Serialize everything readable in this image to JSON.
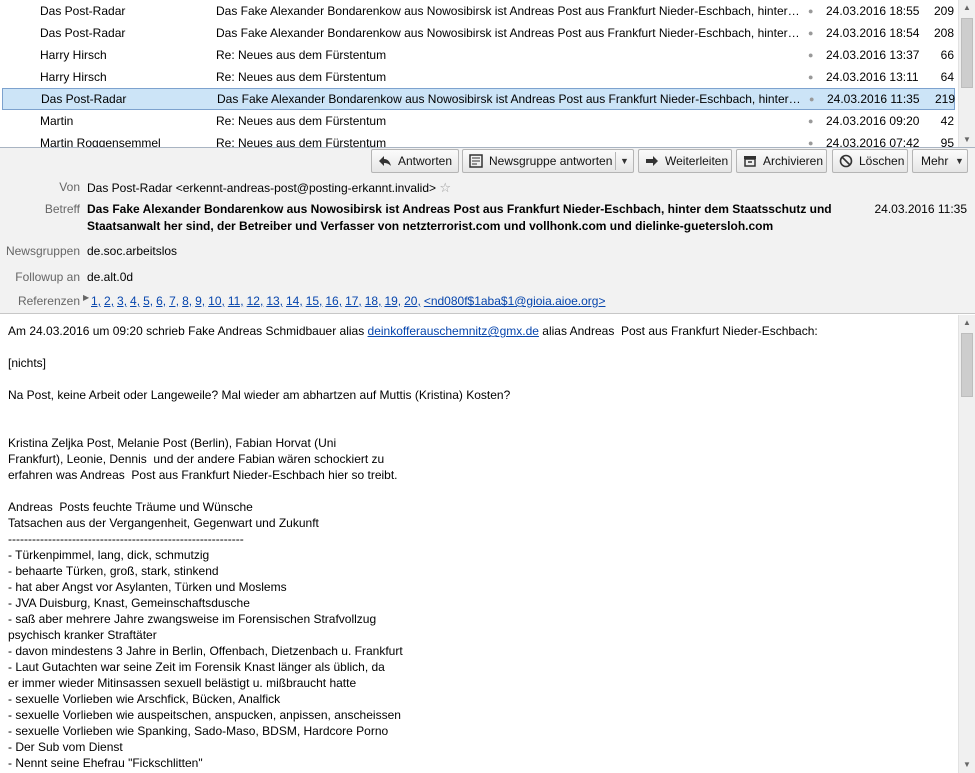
{
  "message_list": [
    {
      "from": "Das Post-Radar",
      "subject": "Das Fake Alexander Bondarenkow aus Nowosibirsk ist Andreas Post aus Frankfurt Nieder-Eschbach, hinter de...",
      "date": "24.03.2016 18:55",
      "size": "209",
      "selected": false
    },
    {
      "from": "Das Post-Radar",
      "subject": "Das Fake Alexander Bondarenkow aus Nowosibirsk ist Andreas Post aus Frankfurt Nieder-Eschbach, hinter de...",
      "date": "24.03.2016 18:54",
      "size": "208",
      "selected": false
    },
    {
      "from": "Harry Hirsch",
      "subject": "Re: Neues aus dem Fürstentum",
      "date": "24.03.2016 13:37",
      "size": "66",
      "selected": false
    },
    {
      "from": "Harry Hirsch",
      "subject": "Re: Neues aus dem Fürstentum",
      "date": "24.03.2016 13:11",
      "size": "64",
      "selected": false
    },
    {
      "from": "Das Post-Radar",
      "subject": "Das Fake Alexander Bondarenkow aus Nowosibirsk ist Andreas Post aus Frankfurt Nieder-Eschbach, hinter de...",
      "date": "24.03.2016 11:35",
      "size": "219",
      "selected": true
    },
    {
      "from": "Martin",
      "subject": "Re: Neues aus dem Fürstentum",
      "date": "24.03.2016 09:20",
      "size": "42",
      "selected": false
    },
    {
      "from": "Martin Roggensemmel",
      "subject": "Re: Neues aus dem Fürstentum",
      "date": "24.03.2016 07:42",
      "size": "95",
      "selected": false
    }
  ],
  "toolbar": {
    "reply": "Antworten",
    "reply_group": "Newsgruppe antworten",
    "forward": "Weiterleiten",
    "archive": "Archivieren",
    "delete": "Löschen",
    "more": "Mehr"
  },
  "header": {
    "from_label": "Von",
    "from_value": "Das Post-Radar <erkennt-andreas-post@posting-erkannt.invalid>",
    "subject_label": "Betreff",
    "subject_value": "Das Fake Alexander Bondarenkow aus Nowosibirsk ist Andreas Post aus Frankfurt Nieder-Eschbach, hinter dem Staatsschutz und Staatsanwalt her sind, der Betreiber und Verfasser von netzterrorist.com und vollhonk.com und dielinke-guetersloh.com",
    "date": "24.03.2016 11:35",
    "newsgroups_label": "Newsgruppen",
    "newsgroups_value": "de.soc.arbeitslos",
    "followup_label": "Followup an",
    "followup_value": "de.alt.0d",
    "references_label": "Referenzen",
    "references": [
      "1,",
      "2,",
      "3,",
      "4,",
      "5,",
      "6,",
      "7,",
      "8,",
      "9,",
      "10,",
      "11,",
      "12,",
      "13,",
      "14,",
      "15,",
      "16,",
      "17,",
      "18,",
      "19,",
      "20,",
      "<nd080f$1aba$1@gioia.aioe.org>"
    ]
  },
  "body": {
    "intro_before": "Am 24.03.2016 um 09:20 schrieb Fake Andreas Schmidbauer alias ",
    "intro_link": "deinkofferauschemnitz@gmx.de",
    "intro_after": " alias Andreas  Post aus Frankfurt Nieder-Eschbach:",
    "lines": [
      "",
      "[nichts]",
      "",
      "Na Post, keine Arbeit oder Langeweile? Mal wieder am abhartzen auf Muttis (Kristina) Kosten?",
      "",
      "",
      "Kristina Zeljka Post, Melanie Post (Berlin), Fabian Horvat (Uni",
      "Frankfurt), Leonie, Dennis  und der andere Fabian wären schockiert zu",
      "erfahren was Andreas  Post aus Frankfurt Nieder-Eschbach hier so treibt.",
      "",
      "Andreas  Posts feuchte Träume und Wünsche",
      "Tatsachen aus der Vergangenheit, Gegenwart und Zukunft",
      "-----------------------------------------------------------",
      "- Türkenpimmel, lang, dick, schmutzig",
      "- behaarte Türken, groß, stark, stinkend",
      "- hat aber Angst vor Asylanten, Türken und Moslems",
      "- JVA Duisburg, Knast, Gemeinschaftsdusche",
      "- saß aber mehrere Jahre zwangsweise im Forensischen Strafvollzug",
      "psychisch kranker Straftäter",
      "- davon mindestens 3 Jahre in Berlin, Offenbach, Dietzenbach u. Frankfurt",
      "- Laut Gutachten war seine Zeit im Forensik Knast länger als üblich, da",
      "er immer wieder Mitinsassen sexuell belästigt u. mißbraucht hatte",
      "- sexuelle Vorlieben wie Arschfick, Bücken, Analfick",
      "- sexuelle Vorlieben wie auspeitschen, anspucken, anpissen, anscheissen",
      "- sexuelle Vorlieben wie Spanking, Sado-Maso, BDSM, Hardcore Porno",
      "- Der Sub vom Dienst",
      "- Nennt seine Ehefrau \"Fickschlitten\""
    ]
  },
  "colors": {
    "selected_row": "#cce4f7",
    "header_bg": "#f2f2f2",
    "link": "#0645ad"
  }
}
